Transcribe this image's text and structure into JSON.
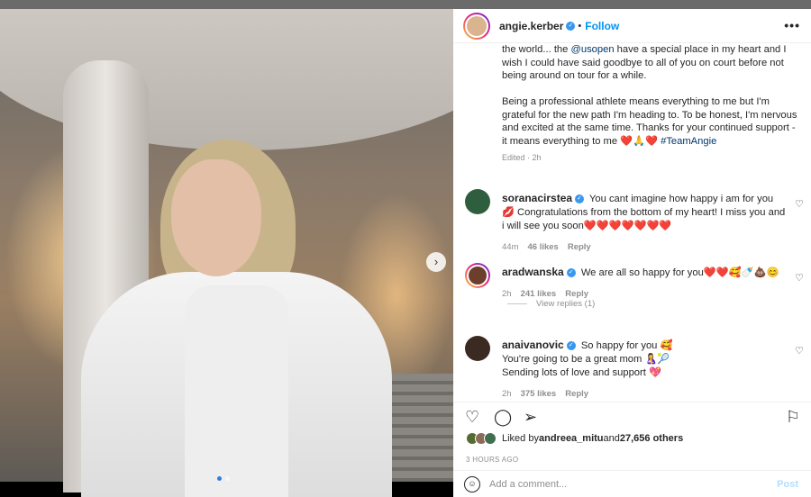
{
  "post": {
    "username": "angie.kerber",
    "follow_label": "Follow",
    "more_label": "•••",
    "caption_para1_a": "the world... the ",
    "caption_mention": "@usopen",
    "caption_para1_b": " have a special place in my heart and I wish I could have said goodbye to all of you on court before not being around on tour for a while.",
    "caption_para2": "Being a professional athlete means everything to me but I'm grateful for the new path I'm heading to. To be honest, I'm nervous and excited at the same time. Thanks for your continued support - it means everything to me ",
    "caption_emojis": "❤️🙏❤️",
    "caption_tag": "#TeamAngie",
    "edited": "Edited · 2h"
  },
  "comments": [
    {
      "username": "soranacirstea",
      "text": "You cant imagine how happy i am for you💋 Congratulations from the bottom of my heart! I miss you and i will see you soon❤️❤️❤️❤️❤️❤️❤️",
      "time": "44m",
      "likes": "46 likes",
      "reply": "Reply"
    },
    {
      "username": "aradwanska",
      "text": "We are all so happy for you❤️❤️🥰🍼💩😊",
      "time": "2h",
      "likes": "241 likes",
      "reply": "Reply",
      "view_replies": "View replies (1)"
    },
    {
      "username": "anaivanovic",
      "text1": "So happy for you 🥰",
      "text2": "You're going to be a great mom 🤱🎾",
      "text3": "Sending lots of love and support 💖",
      "time": "2h",
      "likes": "375 likes",
      "reply": "Reply"
    }
  ],
  "liked": {
    "prefix": "Liked by ",
    "user": "andreea_mitu",
    "middle": " and ",
    "count": "27,656 others"
  },
  "timestamp": "3 HOURS AGO",
  "add_comment": {
    "placeholder": "Add a comment...",
    "post_label": "Post"
  },
  "media": {
    "next_label": "›",
    "current_slide": 1,
    "total_slides": 2
  },
  "colors": {
    "accent": "#0095f6",
    "verified": "#3897f0"
  }
}
